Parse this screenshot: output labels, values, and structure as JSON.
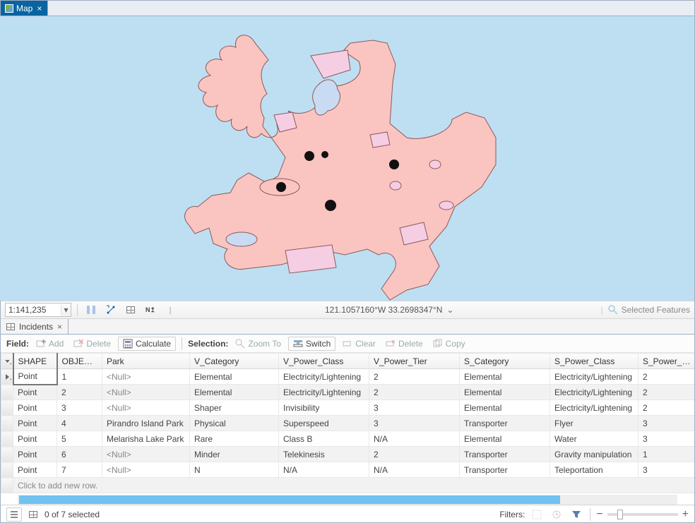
{
  "tabs": {
    "map_label": "Map",
    "incidents_label": "Incidents"
  },
  "map": {
    "scale": "1:141,235",
    "coord_text": "121.1057160°W 33.2698347°N",
    "selected_features_label": "Selected Features"
  },
  "toolbar": {
    "field_label": "Field:",
    "add_label": "Add",
    "delete_label": "Delete",
    "calculate_label": "Calculate",
    "selection_label": "Selection:",
    "zoomto_label": "Zoom To",
    "switch_label": "Switch",
    "clear_label": "Clear",
    "delete2_label": "Delete",
    "copy_label": "Copy"
  },
  "table": {
    "columns": [
      "SHAPE",
      "OBJECTID",
      "Park",
      "V_Category",
      "V_Power_Class",
      "V_Power_Tier",
      "S_Category",
      "S_Power_Class",
      "S_Power_Tier"
    ],
    "rows": [
      {
        "SHAPE": "Point",
        "OBJECTID": "1",
        "Park": "<Null>",
        "V_Category": "Elemental",
        "V_Power_Class": "Electricity/Lightening",
        "V_Power_Tier": "2",
        "S_Category": "Elemental",
        "S_Power_Class": "Electricity/Lightening",
        "S_Power_Tier": "2"
      },
      {
        "SHAPE": "Point",
        "OBJECTID": "2",
        "Park": "<Null>",
        "V_Category": "Elemental",
        "V_Power_Class": "Electricity/Lightening",
        "V_Power_Tier": "2",
        "S_Category": "Elemental",
        "S_Power_Class": "Electricity/Lightening",
        "S_Power_Tier": "2"
      },
      {
        "SHAPE": "Point",
        "OBJECTID": "3",
        "Park": "<Null>",
        "V_Category": "Shaper",
        "V_Power_Class": "Invisibility",
        "V_Power_Tier": "3",
        "S_Category": "Elemental",
        "S_Power_Class": "Electricity/Lightening",
        "S_Power_Tier": "2"
      },
      {
        "SHAPE": "Point",
        "OBJECTID": "4",
        "Park": "Pirandro Island Park",
        "V_Category": "Physical",
        "V_Power_Class": "Superspeed",
        "V_Power_Tier": "3",
        "S_Category": "Transporter",
        "S_Power_Class": "Flyer",
        "S_Power_Tier": "3"
      },
      {
        "SHAPE": "Point",
        "OBJECTID": "5",
        "Park": "Melarisha Lake Park",
        "V_Category": "Rare",
        "V_Power_Class": "Class B",
        "V_Power_Tier": "N/A",
        "S_Category": "Elemental",
        "S_Power_Class": "Water",
        "S_Power_Tier": "3"
      },
      {
        "SHAPE": "Point",
        "OBJECTID": "6",
        "Park": "<Null>",
        "V_Category": "Minder",
        "V_Power_Class": "Telekinesis",
        "V_Power_Tier": "2",
        "S_Category": "Transporter",
        "S_Power_Class": "Gravity manipulation",
        "S_Power_Tier": "1"
      },
      {
        "SHAPE": "Point",
        "OBJECTID": "7",
        "Park": "<Null>",
        "V_Category": "N",
        "V_Power_Class": "N/A",
        "V_Power_Tier": "N/A",
        "S_Category": "Transporter",
        "S_Power_Class": "Teleportation",
        "S_Power_Tier": "3"
      }
    ],
    "add_row_label": "Click to add new row."
  },
  "footer": {
    "selected_text": "0 of 7 selected",
    "filters_label": "Filters:"
  }
}
